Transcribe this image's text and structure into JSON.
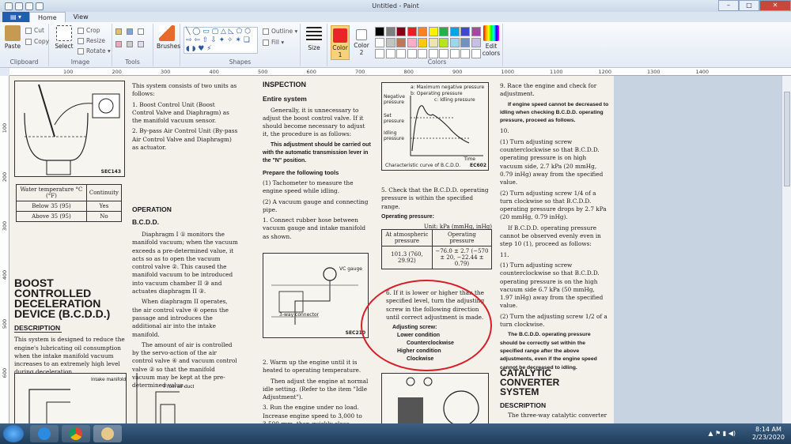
{
  "window": {
    "title": "Untitled - Paint",
    "min": "–",
    "max": "□",
    "close": "✕"
  },
  "tabs": [
    {
      "label": "Home"
    },
    {
      "label": "View"
    }
  ],
  "ribbon": {
    "clipboard": {
      "label": "Clipboard",
      "paste": "Paste",
      "cut": "Cut",
      "copy": "Copy"
    },
    "image": {
      "label": "Image",
      "select": "Select",
      "crop": "Crop",
      "resize": "Resize",
      "rotate": "Rotate ▾"
    },
    "tools": {
      "label": "Tools"
    },
    "brushes": {
      "label": "Brushes"
    },
    "shapes": {
      "label": "Shapes",
      "outline": "Outline ▾",
      "fill": "Fill ▾"
    },
    "size": {
      "label": "Size"
    },
    "color1": {
      "label": "Color 1",
      "color": "#e8262a"
    },
    "color2": {
      "label": "Color 2",
      "color": "#ffffff"
    },
    "colors": {
      "label": "Colors",
      "edit": "Edit colors"
    },
    "palette": [
      "#000000",
      "#7f7f7f",
      "#880015",
      "#ed1c24",
      "#ff7f27",
      "#fff200",
      "#22b14c",
      "#00a2e8",
      "#3f48cc",
      "#a349a4",
      "#ffffff",
      "#c3c3c3",
      "#b97a57",
      "#ffaec9",
      "#ffc90e",
      "#efe4b0",
      "#b5e61d",
      "#99d9ea",
      "#7092be",
      "#c8bfe7"
    ]
  },
  "ruler": {
    "h": [
      "100",
      "200",
      "300",
      "400",
      "500",
      "600",
      "700",
      "800",
      "900",
      "1000",
      "1100",
      "1200",
      "1300",
      "1400"
    ],
    "v": [
      "100",
      "200",
      "300",
      "400",
      "500",
      "600"
    ]
  },
  "doc": {
    "col1": {
      "fig_caption": "SEC143",
      "table": {
        "headers": [
          "Water temperature °C (°F)",
          "Continuity"
        ],
        "rows": [
          [
            "Below 35 (95)",
            "Yes"
          ],
          [
            "Above 35 (95)",
            "No"
          ]
        ]
      },
      "heading": "BOOST CONTROLLED DECELERATION DEVICE (B.C.D.D.)",
      "description_h": "DESCRIPTION",
      "description": "This system is designed to reduce the engine's lubricating oil consumption when the intake manifold vacuum increases to an extremely high level during deceleration.",
      "fig2_label1": "Intake manifold",
      "fig2_label2": "From air duct"
    },
    "col2": {
      "p1": "This system consists of two units as follows:",
      "p2": "1. Boost Control Unit (Boost Control Valve and Diaphragm) as the manifold vacuum sensor.",
      "p3": "2. By-pass Air Control Unit (By-pass Air Control Valve and Diaphragm) as actuator.",
      "operation_h": "OPERATION",
      "bcdd_h": "B.C.D.D.",
      "p4": "Diaphragm I ① monitors the manifold vacuum; when the vacuum exceeds a pre-determined value, it acts so as to open the vacuum control valve ②. This caused the manifold vacuum to be introduced into vacuum chamber II ③ and actuates diaphragm II ③.",
      "p5": "When diaphragm II operates, the air control valve ④ opens the passage and introduces the additional air into the intake manifold.",
      "p6": "The amount of air is controlled by the servo-action of the air control valve ④ and vacuum control valve ② so that the manifold vacuum may be kept at the pre-determined value."
    },
    "col3": {
      "inspection_h": "INSPECTION",
      "entire_h": "Entire system",
      "p1": "Generally, it is unnecessary to adjust the boost control valve. If it should become necessary to adjust it, the procedure is as follows:",
      "p2": "This adjustment should be carried out with the automatic transmission lever in the \"N\" position.",
      "prepare_h": "Prepare the following tools",
      "p3": "(1) Tachometer to measure the engine speed while idling.",
      "p4": "(2) A vacuum gauge and connecting pipe.",
      "p5": "1. Connect rubber hose between vacuum gauge and intake manifold as shown.",
      "fig_vc": "VC gauge",
      "fig_3way": "3-way connector",
      "fig_cap": "SEC210",
      "p6": "2. Warm up the engine until it is heated to operating temperature.",
      "p7": "Then adjust the engine at normal idle setting. (Refer to the item \"Idle Adjustment\").",
      "p8": "3. Run the engine under no load. Increase engine speed to 3,000 to 3,500 rpm, then quickly close throttle"
    },
    "col4": {
      "legend_a": "a: Maximum negative pressure",
      "legend_b": "b: Operating pressure",
      "legend_c": "c: Idling pressure",
      "y1": "Negative pressure",
      "y2": "Set pressure",
      "y3": "Idling pressure",
      "caption": "Characteristic curve of B.C.D.D.",
      "time": "Time",
      "code": "EC602",
      "p1": "5. Check that the B.C.D.D. operating pressure is within the specified range.",
      "op_h": "Operating pressure:",
      "unit": "Unit: kPa (mmHg, inHg)",
      "table": {
        "headers": [
          "At atmospheric pressure",
          "Operating pressure"
        ],
        "rows": [
          [
            "101.3 (760, 29.92)",
            "−76.0 ± 2.7 (−570 ± 20, −22.44 ± 0.79)"
          ]
        ]
      },
      "p2": "6. If it is lower or higher than the specified level, turn the adjusting screw in the following direction until correct adjustment is made.",
      "adj_h": "Adjusting screw:",
      "lower": "Lower condition",
      "ccw": "Counterclockwise",
      "higher": "Higher condition",
      "cw": "Clockwise"
    },
    "col5": {
      "p1": "9. Race the engine and check for adjustment.",
      "p2": "If engine speed cannot be decreased to idling when checking B.C.D.D. operating pressure, proceed as follows.",
      "p3": "10.",
      "p4": "(1) Turn adjusting screw counterclockwise so that B.C.D.D. operating pressure is on high vacuum side, 2.7 kPa (20 mmHg, 0.79 inHg) away from the specified value.",
      "p5": "(2) Turn adjusting screw 1/4 of a turn clockwise so that B.C.D.D. operating pressure drops by 2.7 kPa (20 mmHg, 0.79 inHg).",
      "p6": "If B.C.D.D. operating pressure cannot be observed evenly even in step 10 (1), proceed as follows:",
      "p7": "11.",
      "p8": "(1) Turn adjusting screw counterclockwise so that B.C.D.D. operating pressure is on the high vacuum side 6.7 kPa (50 mmHg, 1.97 inHg) away from the specified value.",
      "p9": "(2) Turn the adjusting screw 1/2 of a turn clockwise.",
      "p10": "The B.C.D.D. operating pressure should be correctly set within the specified range after the above adjustments, even if the engine speed cannot be decreased to idling.",
      "cat_h": "CATALYTIC CONVERTER SYSTEM",
      "desc_h": "DESCRIPTION",
      "p11": "The three-way catalytic converter"
    }
  },
  "taskbar": {
    "time": "8:14 AM",
    "date": "2/23/2020"
  }
}
